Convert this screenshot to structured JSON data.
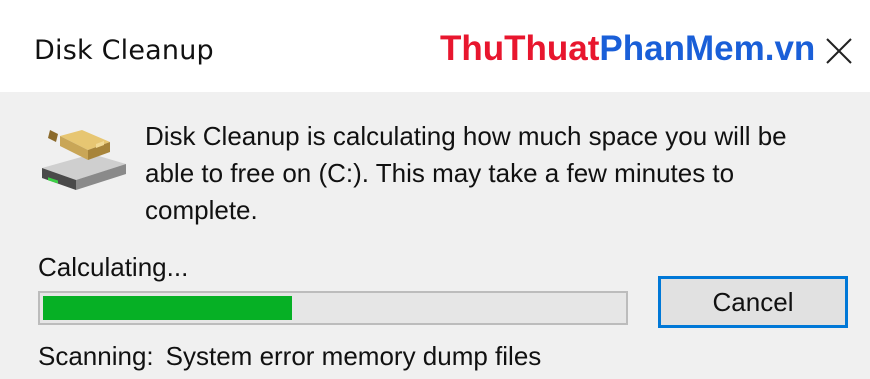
{
  "window": {
    "title": "Disk Cleanup",
    "watermark_part1": "ThuThuat",
    "watermark_part2": "PhanMem.vn",
    "close_icon": "close-icon"
  },
  "message": {
    "lines": [
      "Disk Cleanup is calculating how much space you will be",
      "able to free on  (C:). This may take a few minutes to",
      "complete."
    ]
  },
  "progress": {
    "label": "Calculating...",
    "value": 0.43,
    "fill_color": "#06b025"
  },
  "buttons": {
    "cancel_label": "Cancel"
  },
  "scan": {
    "prefix": "Scanning:",
    "item": "System error memory dump files"
  },
  "colors": {
    "accent": "#0078d7",
    "watermark_red": "#e8162e",
    "watermark_blue": "#1a5fd8"
  }
}
